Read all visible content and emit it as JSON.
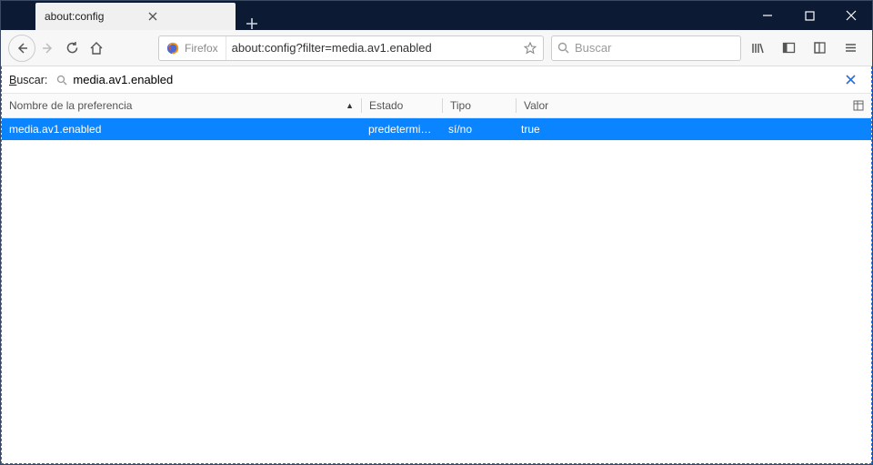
{
  "window": {
    "tab_title": "about:config",
    "url": "about:config?filter=media.av1.enabled",
    "identity_label": "Firefox",
    "search_placeholder": "Buscar"
  },
  "config": {
    "search_label_pre": "B",
    "search_label_rest": "uscar:",
    "search_value": "media.av1.enabled",
    "columns": {
      "name": "Nombre de la preferencia",
      "state": "Estado",
      "type": "Tipo",
      "value": "Valor"
    },
    "row": {
      "name": "media.av1.enabled",
      "state": "predetermina...",
      "type": "sí/no",
      "value": "true"
    }
  }
}
